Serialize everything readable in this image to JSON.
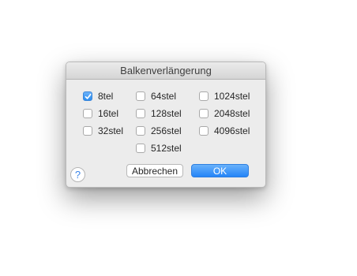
{
  "dialog": {
    "title": "Balkenverlängerung",
    "options": [
      {
        "label": "8tel",
        "checked": true
      },
      {
        "label": "16tel",
        "checked": false
      },
      {
        "label": "32stel",
        "checked": false
      },
      {
        "label": "64stel",
        "checked": false
      },
      {
        "label": "128stel",
        "checked": false
      },
      {
        "label": "256stel",
        "checked": false
      },
      {
        "label": "512stel",
        "checked": false
      },
      {
        "label": "1024stel",
        "checked": false
      },
      {
        "label": "2048stel",
        "checked": false
      },
      {
        "label": "4096stel",
        "checked": false
      }
    ],
    "buttons": {
      "cancel_label": "Abbrechen",
      "ok_label": "OK"
    },
    "help_label": "?"
  }
}
